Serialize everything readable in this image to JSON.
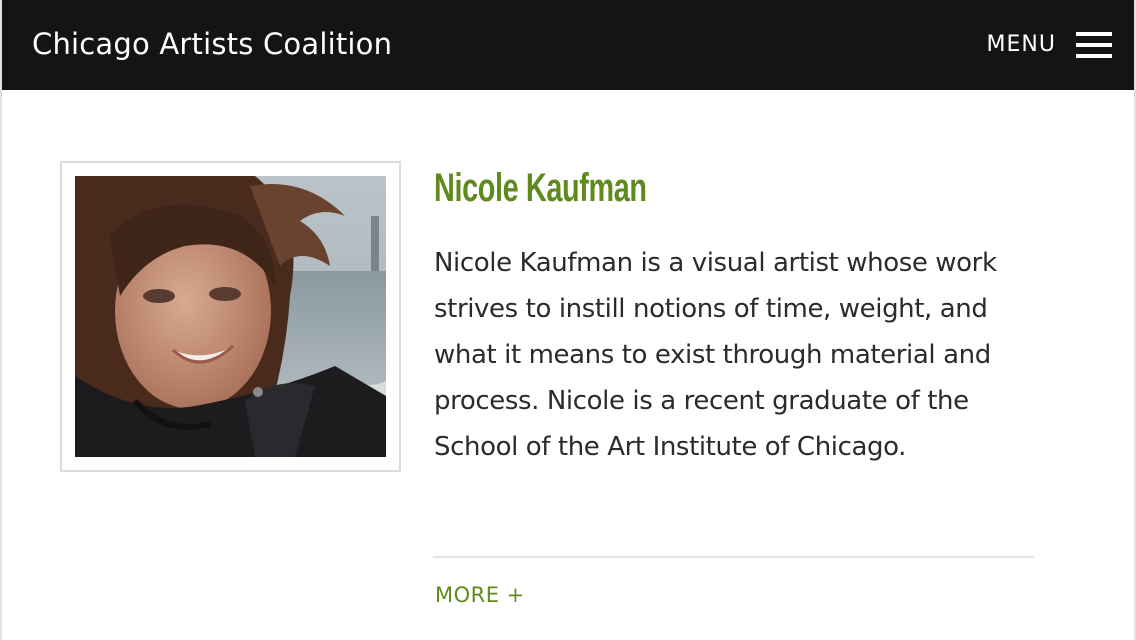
{
  "header": {
    "site_title": "Chicago Artists Coalition",
    "menu_label": "MENU",
    "menu_icon": "hamburger-icon"
  },
  "profile": {
    "photo_alt": "Portrait of Nicole Kaufman by the lakefront",
    "name": "Nicole Kaufman",
    "bio": "Nicole Kaufman is a visual artist whose work strives to instill notions of time, weight, and what it means to exist through material and process. Nicole is a recent graduate of the School of the Art Institute of Chicago.",
    "more_label": "MORE +"
  },
  "colors": {
    "header_bg": "#141414",
    "accent_green": "#5f8a1c",
    "body_text": "#2b2b2b"
  }
}
